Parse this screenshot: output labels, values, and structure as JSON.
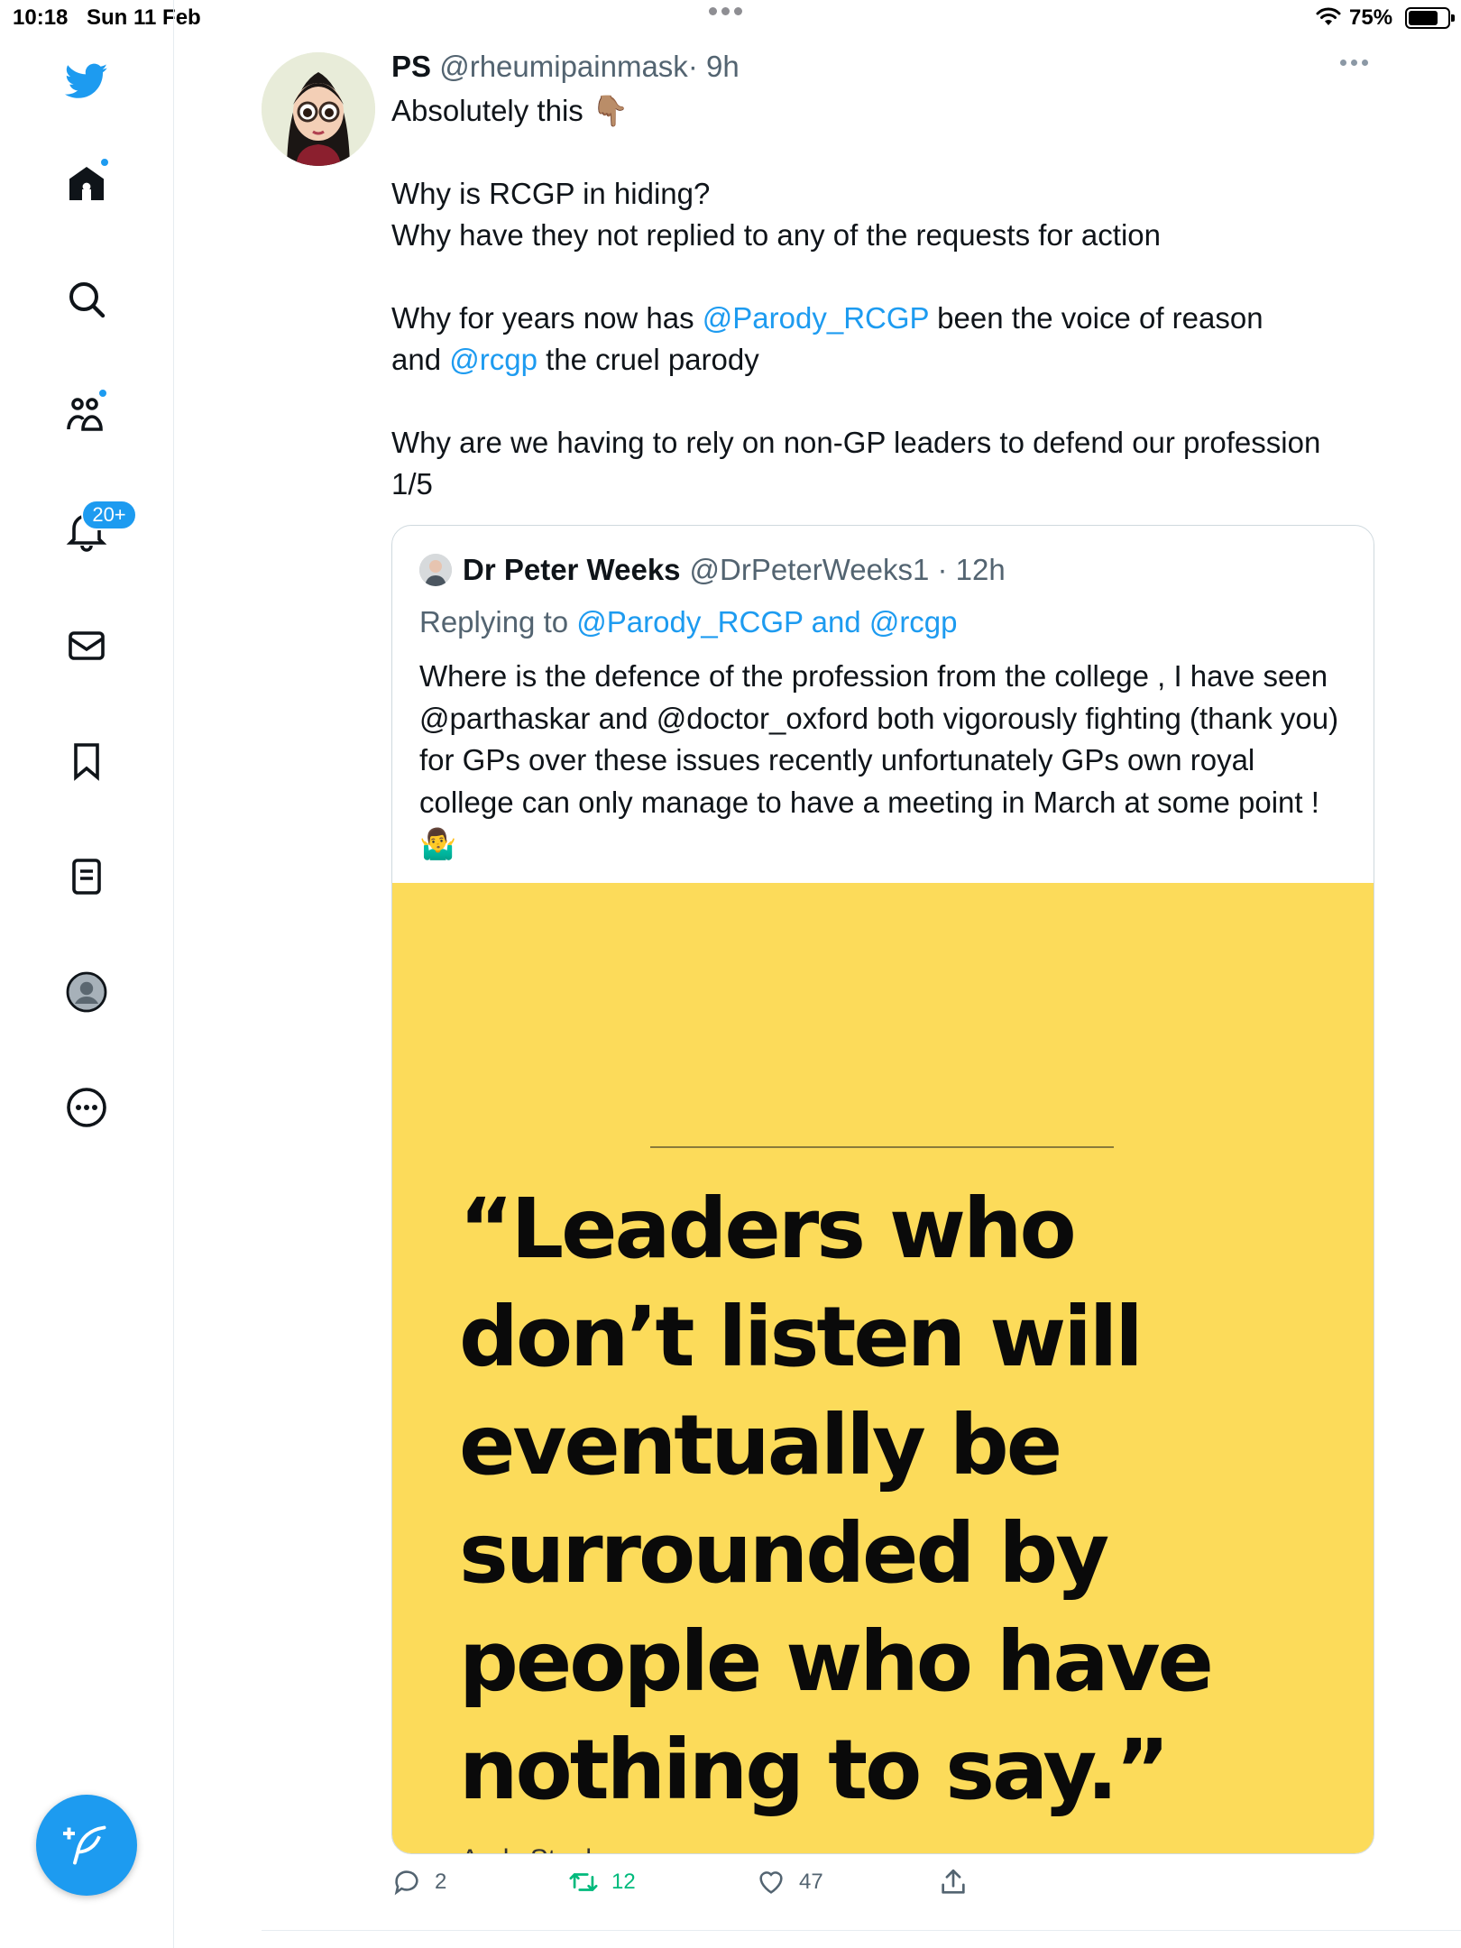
{
  "status_bar": {
    "time": "10:18",
    "date": "Sun 11 Feb",
    "battery_percent": "75%",
    "battery_level": 0.75
  },
  "sidebar": {
    "items": [
      {
        "name": "twitter-logo-icon",
        "icon": "twitter-bird"
      },
      {
        "name": "home",
        "icon": "home",
        "has_dot": true
      },
      {
        "name": "explore",
        "icon": "search"
      },
      {
        "name": "communities",
        "icon": "people",
        "has_dot": true
      },
      {
        "name": "notifications",
        "icon": "bell",
        "badge": "20+"
      },
      {
        "name": "messages",
        "icon": "envelope"
      },
      {
        "name": "bookmarks",
        "icon": "bookmark"
      },
      {
        "name": "lists",
        "icon": "list"
      },
      {
        "name": "profile",
        "icon": "avatar"
      },
      {
        "name": "more",
        "icon": "ellipsis-circle"
      }
    ],
    "notifications_badge": "20+",
    "compose_icon": "feather-plus"
  },
  "tweet": {
    "name": "PS",
    "handle": "@rheumipainmask",
    "time": "· 9h",
    "line1": "Absolutely this",
    "line1_emoji": "👇🏽",
    "line2": "Why is RCGP in hiding?",
    "line3": "Why have they not replied to any of the requests for action",
    "line4_a": "Why for years now has ",
    "mention1": "@Parody_RCGP",
    "line4_b": " been the voice of reason",
    "line5_a": "and ",
    "mention2": "@rcgp",
    "line5_b": " the cruel parody",
    "line6": "Why are we having to rely on non-GP leaders to defend our profession",
    "line7": "1/5"
  },
  "quoted": {
    "name": "Dr Peter Weeks",
    "handle": "@DrPeterWeeks1 · 12h",
    "replying": "Replying to @Parody_RCGP and @rcgp",
    "body": "Where is the defence of the profession from the college , I have seen @parthaskar and @doctor_oxford  both vigorously fighting (thank you)  for GPs over these issues recently unfortunately GPs own royal college can only manage to have a meeting in March at some point  !",
    "body_emoji": "🤷‍♂️",
    "image": {
      "background": "#fcdb5a",
      "quote_lines": [
        "“Leaders who",
        "don’t listen will",
        "eventually be",
        "surrounded by",
        "people who have",
        "nothing to say.”"
      ],
      "author": "Andy Stanley"
    }
  },
  "actions": {
    "replies": "2",
    "retweets": "12",
    "likes": "47",
    "retweet_color": "#00ba7c",
    "accent": "#1d9bf0"
  }
}
